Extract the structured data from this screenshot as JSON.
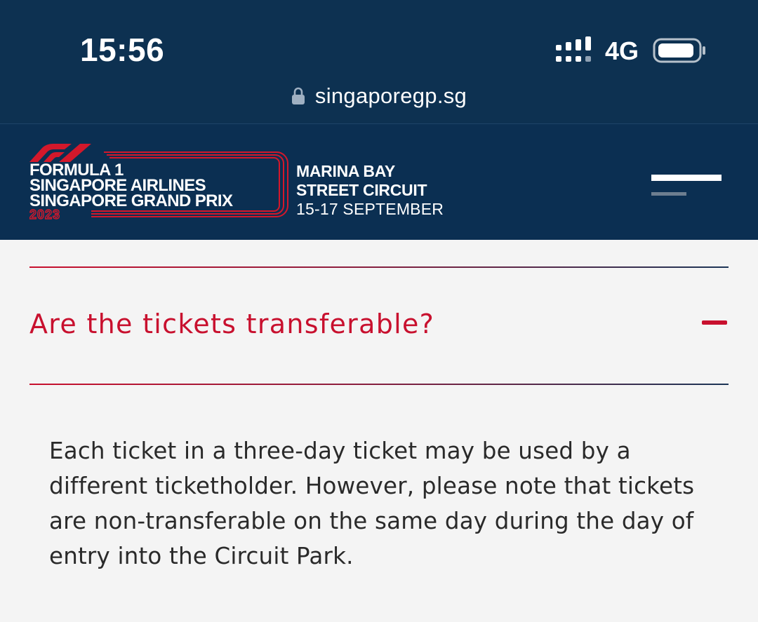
{
  "status_bar": {
    "time": "15:56",
    "network": "4G",
    "icons": [
      "signal-icon",
      "battery-icon"
    ]
  },
  "browser": {
    "url": "singaporegp.sg",
    "icons": [
      "lock-icon"
    ]
  },
  "header": {
    "brand": {
      "line1": "FORMULA 1",
      "line2": "SINGAPORE AIRLINES",
      "line3": "SINGAPORE GRAND PRIX",
      "year": "2023"
    },
    "event": {
      "venue_line1": "MARINA BAY",
      "venue_line2": "STREET CIRCUIT",
      "dates": "15-17 SEPTEMBER"
    },
    "icons": [
      "f1-logo-icon",
      "menu-icon"
    ]
  },
  "faq": {
    "question": "Are the tickets transferable?",
    "answer": "Each ticket in a three-day ticket may be used by a different ticketholder. However, please note that tickets are non-transferable on the same day during the day of entry into the Circuit Park.",
    "icons": [
      "minus-icon"
    ]
  },
  "colors": {
    "header_bg": "#0b2f52",
    "accent_red": "#c8102e",
    "page_bg": "#f4f4f4",
    "text": "#2a2a2a"
  }
}
